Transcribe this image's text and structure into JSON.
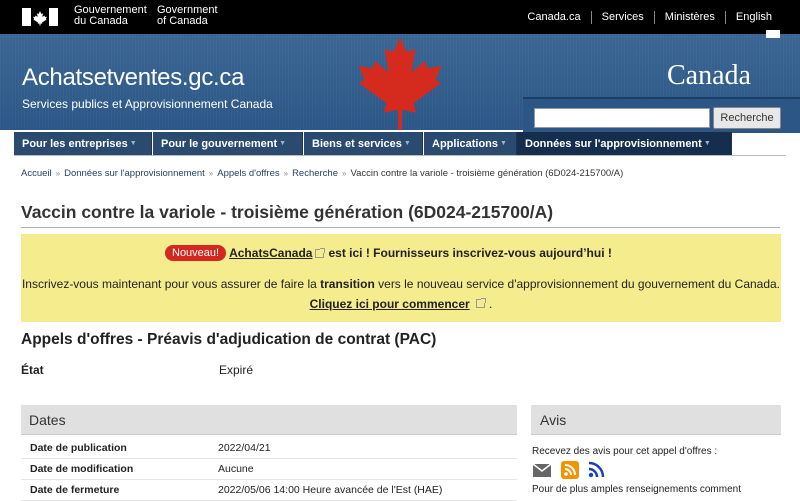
{
  "topbar": {
    "govt_en": "Government\nof Canada",
    "govt_fr": "Gouvernement\ndu Canada",
    "links": [
      "Canada.ca",
      "Services",
      "Ministères",
      "English"
    ]
  },
  "banner": {
    "site_name": "Achatsetventes.gc.ca",
    "site_sub": "Services publics et Approvisionnement Canada",
    "wordmark": "Canada",
    "search_placeholder": "",
    "search_button": "Recherche"
  },
  "nav": {
    "items": [
      "Pour les entreprises",
      "Pour le gouvernement",
      "Biens et services",
      "Applications",
      "Données sur l'approvisionnement"
    ]
  },
  "breadcrumb": {
    "items": [
      "Accueil",
      "Données sur l'approvisionnement",
      "Appels d'offres",
      "Recherche",
      "Vaccin contre la variole - troisième génération (6D024-215700/A)"
    ]
  },
  "page": {
    "title": "Vaccin contre la variole - troisième génération (6D024-215700/A)"
  },
  "notice": {
    "badge": "Nouveau!",
    "link": "AchatsCanada",
    "line1_rest": "est ici ! Fournisseurs inscrivez-vous aujourd’hui !",
    "line2_a": "Inscrivez-vous maintenant pour vous assurer de faire la",
    "line2_b": "transition",
    "line2_c": "vers le nouveau service d'approvisionnement du gouvernement du Canada.",
    "click": "Cliquez ici pour commencer",
    "end": "."
  },
  "section": {
    "title": "Appels d'offres - Préavis d'adjudication de contrat (PAC)",
    "state_label": "État",
    "state_value": "Expiré"
  },
  "dates": {
    "title": "Dates",
    "rows": [
      {
        "k": "Date de publication",
        "v": "2022/04/21"
      },
      {
        "k": "Date de modification",
        "v": "Aucune"
      },
      {
        "k": "Date de fermeture",
        "v": "2022/05/06 14:00 Heure avancée de l'Est (HAE)"
      }
    ]
  },
  "avis": {
    "title": "Avis",
    "text": "Recevez des avis pour cet appel d'offres :",
    "icons": [
      "email-icon",
      "rss-icon",
      "atom-feed-icon"
    ],
    "more": "Pour de plus amples renseignements comment"
  },
  "colors": {
    "topbar": "#000000",
    "banner": "#2b5685",
    "nav": "#2a4a6f",
    "nav_active": "#152e4d",
    "notice_bg": "#f5ec8e",
    "badge": "#d3271f",
    "leaf": "#d52b1e"
  }
}
